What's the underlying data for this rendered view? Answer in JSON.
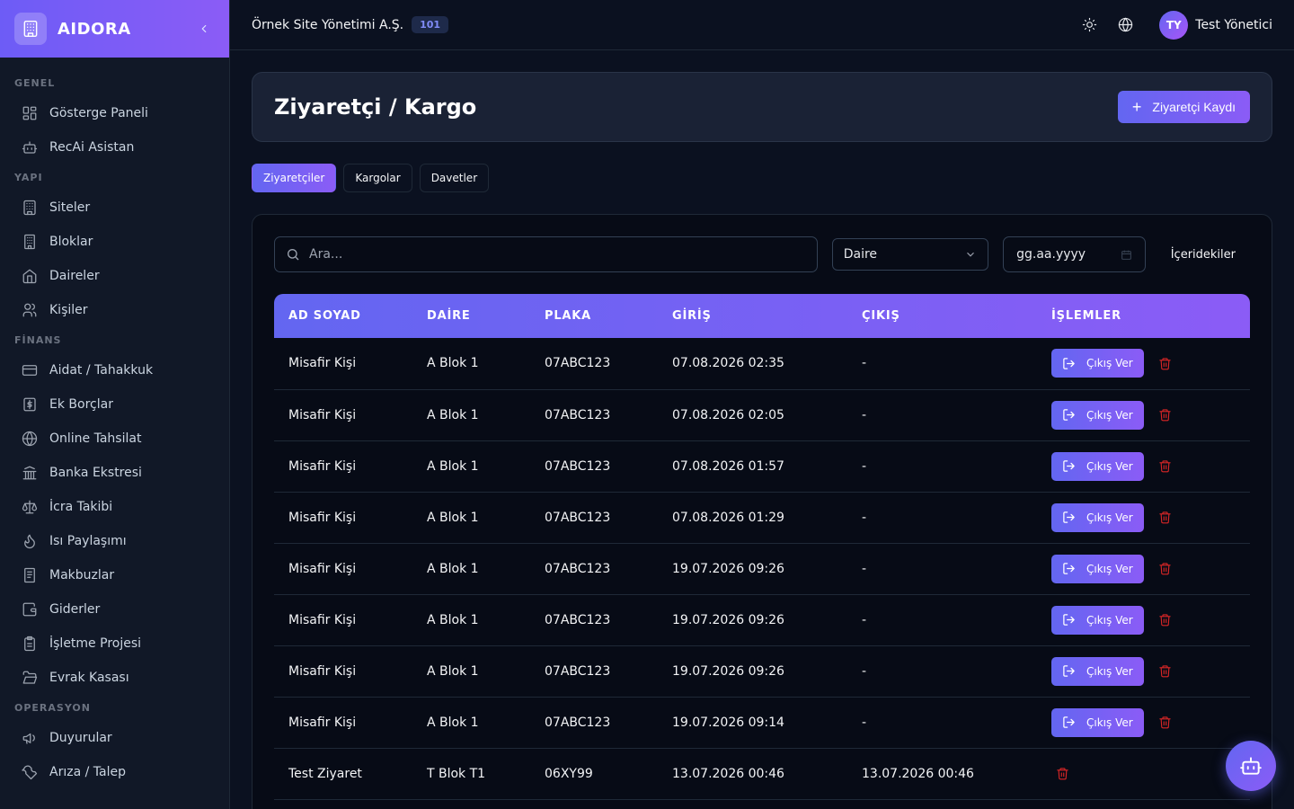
{
  "brand": {
    "name": "AIDORA"
  },
  "sidebar": {
    "sections": [
      {
        "title": "GENEL",
        "items": [
          {
            "label": "Gösterge Paneli",
            "icon": "dashboard-icon"
          },
          {
            "label": "RecAi Asistan",
            "icon": "bot-icon"
          }
        ]
      },
      {
        "title": "YAPI",
        "items": [
          {
            "label": "Siteler",
            "icon": "building-icon"
          },
          {
            "label": "Bloklar",
            "icon": "blocks-icon"
          },
          {
            "label": "Daireler",
            "icon": "home-icon"
          },
          {
            "label": "Kişiler",
            "icon": "users-icon"
          }
        ]
      },
      {
        "title": "FİNANS",
        "items": [
          {
            "label": "Aidat / Tahakkuk",
            "icon": "credit-card-icon"
          },
          {
            "label": "Ek Borçlar",
            "icon": "dollar-icon"
          },
          {
            "label": "Online Tahsilat",
            "icon": "globe-icon"
          },
          {
            "label": "Banka Ekstresi",
            "icon": "bank-icon"
          },
          {
            "label": "İcra Takibi",
            "icon": "scale-icon"
          },
          {
            "label": "Isı Paylaşımı",
            "icon": "flame-icon"
          },
          {
            "label": "Makbuzlar",
            "icon": "receipt-icon"
          },
          {
            "label": "Giderler",
            "icon": "wallet-icon"
          },
          {
            "label": "İşletme Projesi",
            "icon": "clipboard-icon"
          },
          {
            "label": "Evrak Kasası",
            "icon": "folder-icon"
          }
        ]
      },
      {
        "title": "OPERASYON",
        "items": [
          {
            "label": "Duyurular",
            "icon": "megaphone-icon"
          },
          {
            "label": "Arıza / Talep",
            "icon": "wrench-icon"
          }
        ]
      }
    ]
  },
  "topbar": {
    "org_name": "Örnek Site Yönetimi A.Ş.",
    "org_badge": "101",
    "user_initials": "TY",
    "user_name": "Test Yönetici"
  },
  "page": {
    "title": "Ziyaretçi / Kargo",
    "primary_action": "Ziyaretçi Kaydı",
    "tabs": [
      "Ziyaretçiler",
      "Kargolar",
      "Davetler"
    ],
    "active_tab": 0
  },
  "filters": {
    "search_placeholder": "Ara...",
    "apartment_select": "Daire",
    "date_placeholder": "gg.aa.yyyy",
    "inside_label": "İçeridekiler"
  },
  "table": {
    "columns": [
      "AD SOYAD",
      "DAİRE",
      "PLAKA",
      "GİRİŞ",
      "ÇIKIŞ",
      "İŞLEMLER"
    ],
    "exit_label": "Çıkış Ver",
    "rows": [
      {
        "name": "Misafir Kişi",
        "apt": "A Blok 1",
        "plate": "07ABC123",
        "in": "07.08.2026 02:35",
        "out": "-",
        "can_exit": true
      },
      {
        "name": "Misafir Kişi",
        "apt": "A Blok 1",
        "plate": "07ABC123",
        "in": "07.08.2026 02:05",
        "out": "-",
        "can_exit": true
      },
      {
        "name": "Misafir Kişi",
        "apt": "A Blok 1",
        "plate": "07ABC123",
        "in": "07.08.2026 01:57",
        "out": "-",
        "can_exit": true
      },
      {
        "name": "Misafir Kişi",
        "apt": "A Blok 1",
        "plate": "07ABC123",
        "in": "07.08.2026 01:29",
        "out": "-",
        "can_exit": true
      },
      {
        "name": "Misafir Kişi",
        "apt": "A Blok 1",
        "plate": "07ABC123",
        "in": "19.07.2026 09:26",
        "out": "-",
        "can_exit": true
      },
      {
        "name": "Misafir Kişi",
        "apt": "A Blok 1",
        "plate": "07ABC123",
        "in": "19.07.2026 09:26",
        "out": "-",
        "can_exit": true
      },
      {
        "name": "Misafir Kişi",
        "apt": "A Blok 1",
        "plate": "07ABC123",
        "in": "19.07.2026 09:26",
        "out": "-",
        "can_exit": true
      },
      {
        "name": "Misafir Kişi",
        "apt": "A Blok 1",
        "plate": "07ABC123",
        "in": "19.07.2026 09:14",
        "out": "-",
        "can_exit": true
      },
      {
        "name": "Test Ziyaret",
        "apt": "T Blok T1",
        "plate": "06XY99",
        "in": "13.07.2026 00:46",
        "out": "13.07.2026 00:46",
        "can_exit": false
      }
    ]
  },
  "colors": {
    "accent_start": "#6366f1",
    "accent_end": "#8b5cf6",
    "danger": "#dc2626",
    "background": "#0b1120"
  }
}
